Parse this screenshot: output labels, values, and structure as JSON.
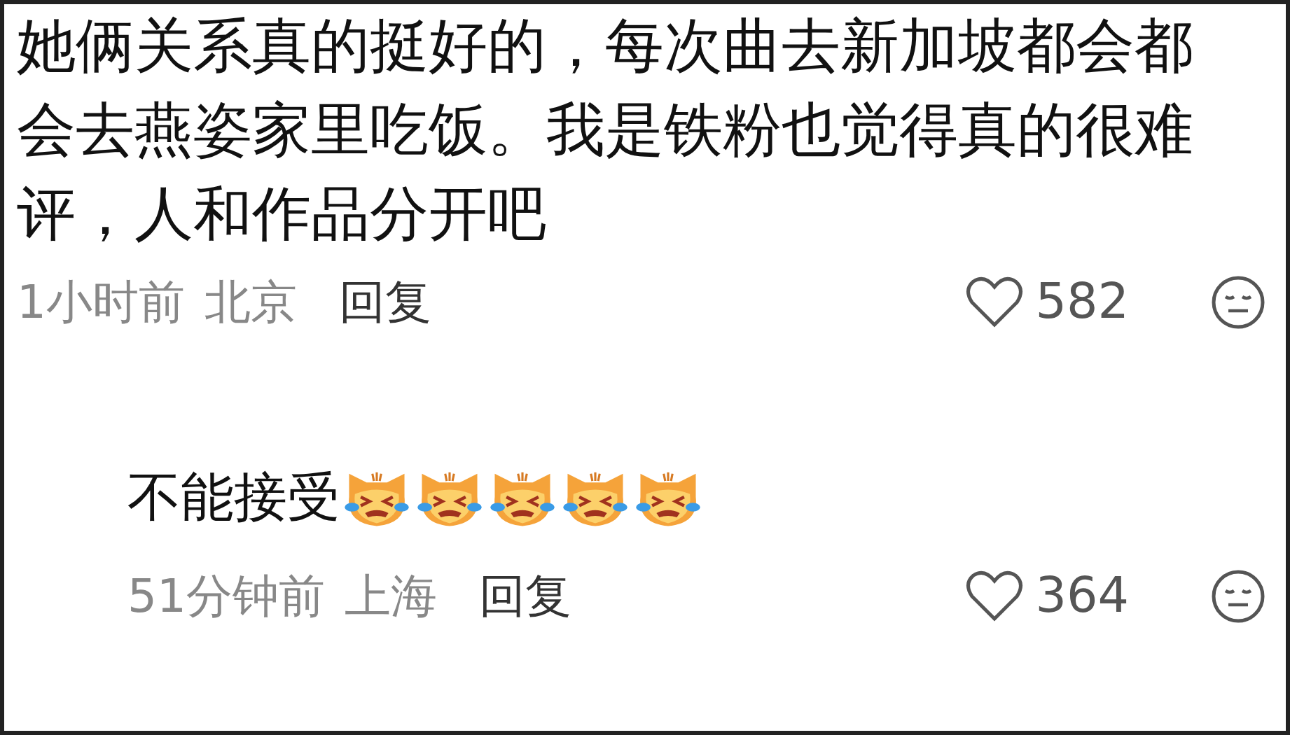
{
  "comments": [
    {
      "text": "她俩关系真的挺好的，每次曲去新加坡都会都会去燕姿家里吃饭。我是铁粉也觉得真的很难评，人和作品分开吧",
      "time": "1小时前",
      "location": "北京",
      "reply_label": "回复",
      "likes": "582",
      "is_reply": false
    },
    {
      "text": "不能接受",
      "emojis": [
        {
          "kind": "crying-cat"
        },
        {
          "kind": "crying-cat"
        },
        {
          "kind": "crying-cat"
        },
        {
          "kind": "crying-cat"
        },
        {
          "kind": "crying-cat"
        }
      ],
      "time": "51分钟前",
      "location": "上海",
      "reply_label": "回复",
      "likes": "364",
      "is_reply": true
    }
  ]
}
